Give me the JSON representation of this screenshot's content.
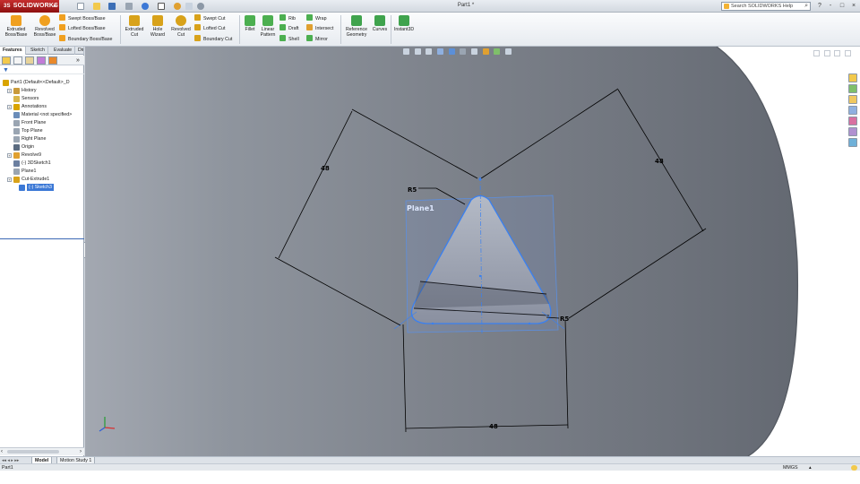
{
  "app": {
    "logo": "SOLIDWORKS",
    "doc_title": "Part1 *",
    "search_placeholder": "Search SOLIDWORKS Help",
    "window_controls": [
      "?",
      "-",
      "□",
      "×"
    ]
  },
  "command_manager": {
    "big": [
      {
        "label": "Extruded\nBoss/Base",
        "icon": "extruded-boss-icon",
        "color": "#f0a020"
      },
      {
        "label": "Revolved\nBoss/Base",
        "icon": "revolved-boss-icon",
        "color": "#f0a020"
      },
      {
        "label": "Extruded\nCut",
        "icon": "extruded-cut-icon",
        "color": "#d8a21a"
      },
      {
        "label": "Hole\nWizard",
        "icon": "hole-wizard-icon",
        "color": "#d8a21a"
      },
      {
        "label": "Revolved\nCut",
        "icon": "revolved-cut-icon",
        "color": "#d8a21a"
      },
      {
        "label": "Fillet",
        "icon": "fillet-icon",
        "color": "#4caf50"
      },
      {
        "label": "Linear\nPattern",
        "icon": "linear-pattern-icon",
        "color": "#4caf50"
      },
      {
        "label": "Reference\nGeometry",
        "icon": "reference-geometry-icon",
        "color": "#3fa34d"
      },
      {
        "label": "Curves",
        "icon": "curves-icon",
        "color": "#3fa34d"
      },
      {
        "label": "Instant3D",
        "icon": "instant3d-icon",
        "color": "#3fa34d"
      }
    ],
    "small_boss": [
      "Swept Boss/Base",
      "Lofted Boss/Base",
      "Boundary Boss/Base"
    ],
    "small_cut": [
      "Swept Cut",
      "Lofted Cut",
      "Boundary Cut"
    ],
    "small_features_a": [
      "Rib",
      "Draft",
      "Shell"
    ],
    "small_features_b": [
      "Wrap",
      "Intersect",
      "Mirror"
    ]
  },
  "left_panel": {
    "tabs": [
      "Features",
      "Sketch",
      "Evaluate",
      "DimXpert"
    ],
    "active_tab": "Features",
    "tree": [
      {
        "label": "Part1  (Default<<Default>_D",
        "indent": 0,
        "expander": false,
        "icon_color": "#d9a400"
      },
      {
        "label": "History",
        "indent": 1,
        "expander": true,
        "icon_color": "#c99a3a"
      },
      {
        "label": "Sensors",
        "indent": 1,
        "expander": false,
        "icon_color": "#d8b64a"
      },
      {
        "label": "Annotations",
        "indent": 1,
        "expander": true,
        "icon_color": "#d9a400"
      },
      {
        "label": "Material <not specified>",
        "indent": 1,
        "expander": false,
        "icon_color": "#6b8db8"
      },
      {
        "label": "Front Plane",
        "indent": 1,
        "expander": false,
        "icon_color": "#9aa5b2"
      },
      {
        "label": "Top Plane",
        "indent": 1,
        "expander": false,
        "icon_color": "#9aa5b2"
      },
      {
        "label": "Right Plane",
        "indent": 1,
        "expander": false,
        "icon_color": "#9aa5b2"
      },
      {
        "label": "Origin",
        "indent": 1,
        "expander": false,
        "icon_color": "#5b6b80"
      },
      {
        "label": "Revolve9",
        "indent": 1,
        "expander": true,
        "icon_color": "#e0a030"
      },
      {
        "label": "(-) 3DSketch1",
        "indent": 1,
        "expander": false,
        "icon_color": "#6b7fa0"
      },
      {
        "label": "Plane1",
        "indent": 1,
        "expander": false,
        "icon_color": "#9aa5b2"
      },
      {
        "label": "Cut-Extrude1",
        "indent": 1,
        "expander": true,
        "icon_color": "#d8a21a"
      },
      {
        "label": "(-) Sketch3",
        "indent": 2,
        "expander": false,
        "icon_color": "#3b78d6",
        "selected": true
      }
    ]
  },
  "viewport": {
    "plane_label": "Plane1",
    "dimensions": {
      "top_left": "48",
      "top_right": "48",
      "bottom": "48",
      "radius_top": "R5",
      "radius_right": "R5"
    }
  },
  "bottom_tabs": [
    "Model",
    "Motion Study 1"
  ],
  "status": {
    "left": "Part1",
    "units": "MMGS",
    "units_arrow": "▴"
  }
}
